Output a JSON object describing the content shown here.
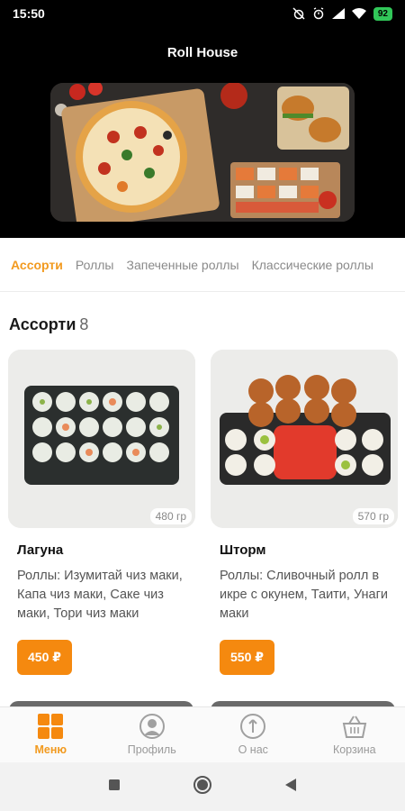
{
  "status_bar": {
    "time": "15:50",
    "battery": "92",
    "icons": [
      "alarm-off-icon",
      "alarm-icon",
      "signal-icon",
      "wifi-icon",
      "battery-icon"
    ]
  },
  "header": {
    "title": "Roll House",
    "banner": "food-banner"
  },
  "tabs": [
    {
      "label": "Ассорти",
      "active": true
    },
    {
      "label": "Роллы",
      "active": false
    },
    {
      "label": "Запеченные роллы",
      "active": false
    },
    {
      "label": "Классические роллы",
      "active": false
    }
  ],
  "section": {
    "title": "Ассорти",
    "count": "8"
  },
  "products": [
    {
      "name": "Лагуна",
      "weight": "480 гр",
      "description": "Роллы: Изумитай чиз маки, Капа чиз маки, Саке чиз маки, Тори чиз маки",
      "price": "450 ₽"
    },
    {
      "name": "Шторм",
      "weight": "570 гр",
      "description": "Роллы: Сливочный ролл в икре с окунем, Таити, Унаги маки",
      "price": "550 ₽"
    }
  ],
  "bottom_nav": [
    {
      "label": "Меню",
      "icon": "menu-grid-icon",
      "active": true
    },
    {
      "label": "Профиль",
      "icon": "profile-icon",
      "active": false
    },
    {
      "label": "О нас",
      "icon": "info-icon",
      "active": false
    },
    {
      "label": "Корзина",
      "icon": "basket-icon",
      "active": false
    }
  ],
  "colors": {
    "accent": "#f5890f",
    "tab_active": "#f29a1f",
    "header_bg": "#000000"
  }
}
